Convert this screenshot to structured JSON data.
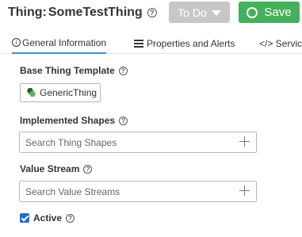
{
  "header": {
    "title_prefix": "Thing:",
    "thing_name": "SomeTestThing",
    "help_icon": "?",
    "todo_label": "To Do",
    "save_label": "Save"
  },
  "tabs": [
    {
      "label": "General Information",
      "icon": "info-icon",
      "active": true
    },
    {
      "label": "Properties and Alerts",
      "icon": "list-icon",
      "active": false
    },
    {
      "label": "</> Service",
      "icon": "code-icon",
      "active": false
    }
  ],
  "form": {
    "base_template": {
      "label": "Base Thing Template",
      "value": "GenericThing"
    },
    "implemented_shapes": {
      "label": "Implemented Shapes",
      "placeholder": "Search Thing Shapes"
    },
    "value_stream": {
      "label": "Value Stream",
      "placeholder": "Search Value Streams"
    },
    "active": {
      "label": "Active",
      "checked": true
    }
  },
  "colors": {
    "save": "#44b05a",
    "todo": "#c7c7c7",
    "tab_accent": "#3c8fcf",
    "checkbox": "#1f6fcf"
  }
}
